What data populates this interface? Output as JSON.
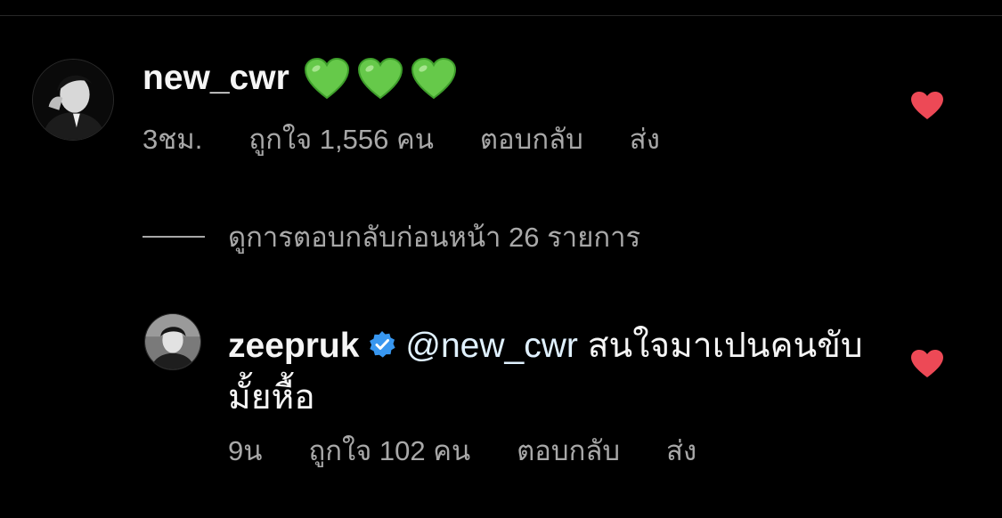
{
  "colors": {
    "background": "#000000",
    "primary_text": "#f5f5f5",
    "secondary_text": "#a8a8a8",
    "like_red": "#ed4956",
    "verified_blue": "#3897f0",
    "mention": "#e0f1ff"
  },
  "comment": {
    "avatar_icon": "profile-photo-icon",
    "username": "new_cwr",
    "emoji_text": "💚💚💚",
    "emoji_icons": [
      "green-heart-icon",
      "green-heart-icon",
      "green-heart-icon"
    ],
    "time": "3ชม.",
    "likes_label": "ถูกใจ 1,556 คน",
    "reply_label": "ตอบกลับ",
    "send_label": "ส่ง",
    "liked": true,
    "like_icon": "heart-filled-icon"
  },
  "view_replies": {
    "label": "ดูการตอบกลับก่อนหน้า 26 รายการ"
  },
  "reply": {
    "avatar_icon": "profile-photo-icon",
    "username": "zeepruk",
    "verified_icon": "verified-badge-icon",
    "mention": "@new_cwr",
    "text": "สนใจมาเปนคนขับมั้ยหื้อ",
    "time": "9น",
    "likes_label": "ถูกใจ 102 คน",
    "reply_label": "ตอบกลับ",
    "send_label": "ส่ง",
    "liked": true,
    "like_icon": "heart-filled-icon"
  }
}
